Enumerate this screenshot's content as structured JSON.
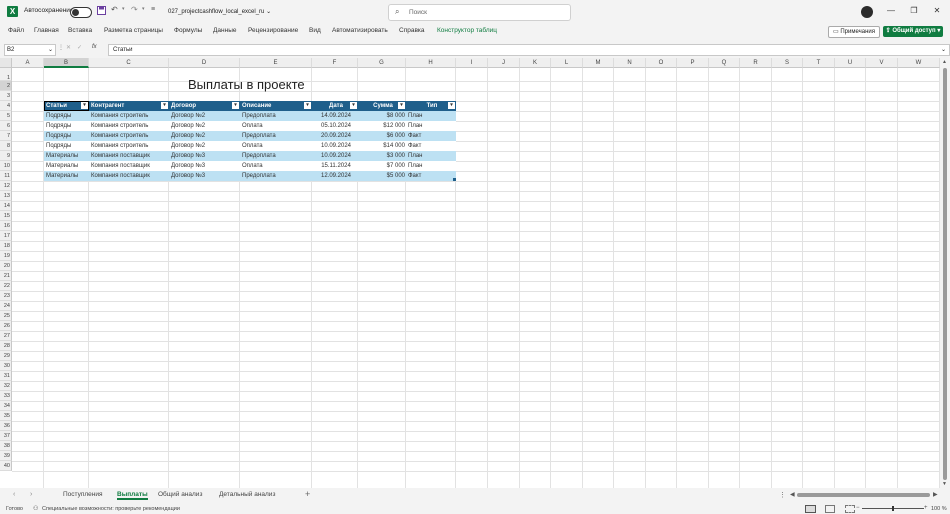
{
  "titlebar": {
    "logo": "X",
    "autosave_label": "Автосохранение",
    "filename": "027_projectcashflow_local_excel_ru",
    "search_placeholder": "Поиск",
    "qat_more": "≡"
  },
  "menu": {
    "items": [
      "Файл",
      "Главная",
      "Вставка",
      "Разметка страницы",
      "Формулы",
      "Данные",
      "Рецензирование",
      "Вид",
      "Автоматизировать",
      "Справка",
      "Конструктор таблиц"
    ],
    "notes_label": "Примечания",
    "share_label": "Общий доступ"
  },
  "formula_bar": {
    "name_box": "B2",
    "fx": "fx",
    "content": "Статьи"
  },
  "columns": [
    "A",
    "B",
    "C",
    "D",
    "E",
    "F",
    "G",
    "H",
    "I",
    "J",
    "K",
    "L",
    "M",
    "N",
    "O",
    "P",
    "Q",
    "R",
    "S",
    "T",
    "U",
    "V",
    "W"
  ],
  "rows": [
    "1",
    "2",
    "3",
    "4",
    "5",
    "6",
    "7",
    "8",
    "9",
    "10",
    "11",
    "12",
    "13",
    "14",
    "15",
    "16",
    "17",
    "18",
    "19",
    "20",
    "21",
    "22",
    "23",
    "24",
    "25",
    "26",
    "27",
    "28",
    "29",
    "30",
    "31",
    "32",
    "33",
    "34",
    "35",
    "36",
    "37",
    "38",
    "39",
    "40"
  ],
  "sheet_title": "Выплаты в проекте",
  "table": {
    "headers": [
      "Статьи",
      "Контрагент",
      "Договор",
      "Описание",
      "Дата",
      "Сумма",
      "Тип"
    ],
    "rows": [
      [
        "Подряды",
        "Компания строитель",
        "Договор №2",
        "Предоплата",
        "14.09.2024",
        "$8 000",
        "План"
      ],
      [
        "Подряды",
        "Компания строитель",
        "Договор №2",
        "Оплата",
        "05.10.2024",
        "$12 000",
        "План"
      ],
      [
        "Подряды",
        "Компания строитель",
        "Договор №2",
        "Предоплата",
        "20.09.2024",
        "$6 000",
        "Факт"
      ],
      [
        "Подряды",
        "Компания строитель",
        "Договор №2",
        "Оплата",
        "10.09.2024",
        "$14 000",
        "Факт"
      ],
      [
        "Материалы",
        "Компания поставщик",
        "Договор №3",
        "Предоплата",
        "10.09.2024",
        "$3 000",
        "План"
      ],
      [
        "Материалы",
        "Компания поставщик",
        "Договор №3",
        "Оплата",
        "15.11.2024",
        "$7 000",
        "План"
      ],
      [
        "Материалы",
        "Компания поставщик",
        "Договор №3",
        "Предоплата",
        "12.09.2024",
        "$5 000",
        "Факт"
      ]
    ],
    "header_color": "#1f5f8b",
    "band_color": "#bde1f3"
  },
  "sheets": {
    "tabs": [
      "Поступления",
      "Выплаты",
      "Общий анализ",
      "Детальный анализ"
    ],
    "active": "Выплаты"
  },
  "status": {
    "ready": "Готово",
    "accessibility": "Специальные возможности: проверьте рекомендации",
    "zoom": "100 %"
  },
  "colors": {
    "excel_green": "#107c41"
  }
}
